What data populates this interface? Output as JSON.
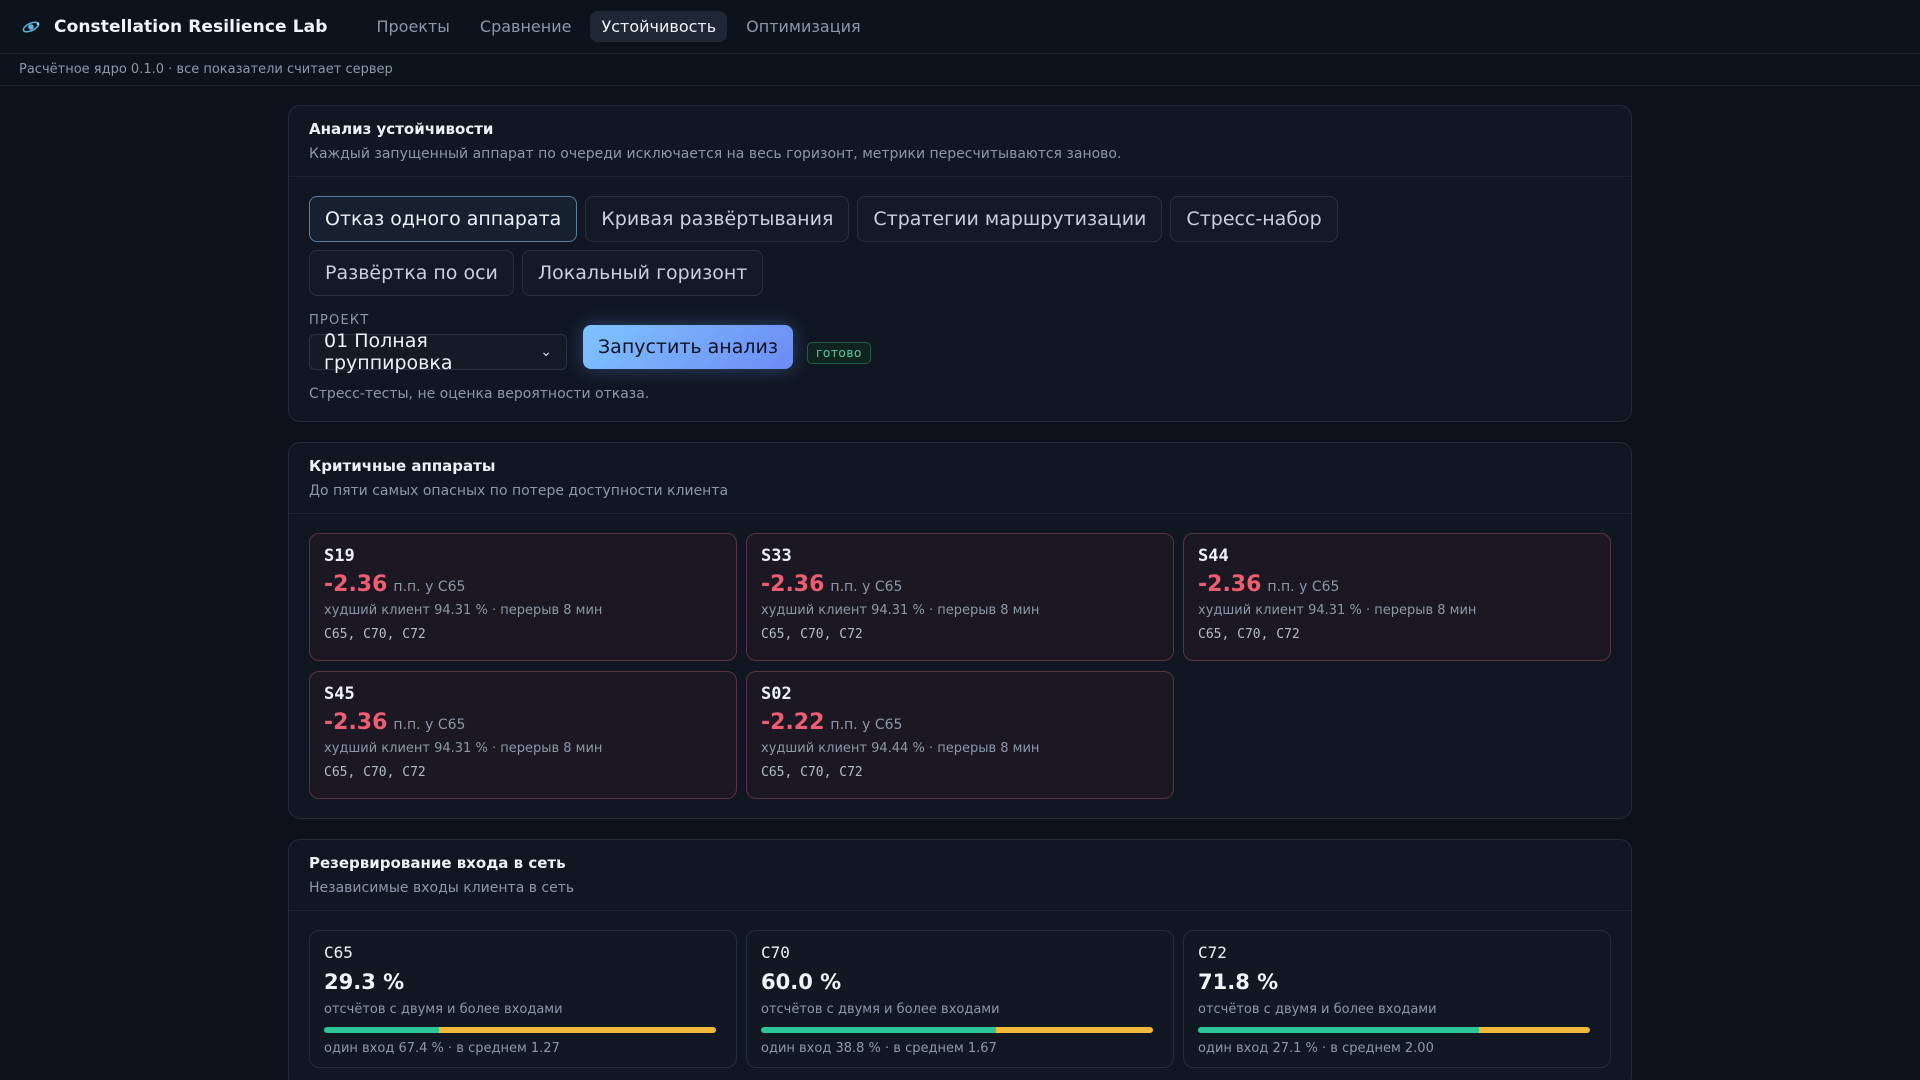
{
  "header": {
    "app_title": "Constellation Resilience Lab",
    "logo_icon": "satellite-icon",
    "nav": [
      {
        "label": "Проекты"
      },
      {
        "label": "Сравнение"
      },
      {
        "label": "Устойчивость",
        "active": true
      },
      {
        "label": "Оптимизация"
      }
    ],
    "subtitle": "Расчётное ядро 0.1.0 · все показатели считает сервер"
  },
  "analysis": {
    "title": "Анализ устойчивости",
    "subtitle": "Каждый запущенный аппарат по очереди исключается на весь горизонт, метрики пересчитываются заново.",
    "modes": [
      {
        "label": "Отказ одного аппарата",
        "active": true
      },
      {
        "label": "Кривая развёртывания"
      },
      {
        "label": "Стратегии маршрутизации"
      },
      {
        "label": "Стресс-набор"
      },
      {
        "label": "Развёртка по оси"
      },
      {
        "label": "Локальный горизонт"
      }
    ],
    "project_label": "ПРОЕКТ",
    "project_value": "01 Полная группировка",
    "run_label": "Запустить анализ",
    "status": "готово",
    "note": "Стресс-тесты, не оценка вероятности отказа."
  },
  "critical": {
    "title": "Критичные аппараты",
    "subtitle": "До пяти самых опасных по потере доступности клиента",
    "items": [
      {
        "name": "S19",
        "delta": "-2.36",
        "unit": "п.п. у C65",
        "detail": "худший клиент 94.31 % · перерыв 8 мин",
        "clients": "C65, C70, C72"
      },
      {
        "name": "S33",
        "delta": "-2.36",
        "unit": "п.п. у C65",
        "detail": "худший клиент 94.31 % · перерыв 8 мин",
        "clients": "C65, C70, C72"
      },
      {
        "name": "S44",
        "delta": "-2.36",
        "unit": "п.п. у C65",
        "detail": "худший клиент 94.31 % · перерыв 8 мин",
        "clients": "C65, C70, C72"
      },
      {
        "name": "S45",
        "delta": "-2.36",
        "unit": "п.п. у C65",
        "detail": "худший клиент 94.31 % · перерыв 8 мин",
        "clients": "C65, C70, C72"
      },
      {
        "name": "S02",
        "delta": "-2.22",
        "unit": "п.п. у C65",
        "detail": "худший клиент 94.44 % · перерыв 8 мин",
        "clients": "C65, C70, C72"
      }
    ]
  },
  "redundancy": {
    "title": "Резервирование входа в сеть",
    "subtitle": "Независимые входы клиента в сеть",
    "items": [
      {
        "name": "C65",
        "pct": "29.3 %",
        "desc": "отсчётов с двумя и более входами",
        "multi_fraction": 0.293,
        "foot": "один вход 67.4 % · в среднем 1.27"
      },
      {
        "name": "C70",
        "pct": "60.0 %",
        "desc": "отсчётов с двумя и более входами",
        "multi_fraction": 0.6,
        "foot": "один вход 38.8 % · в среднем 1.67"
      },
      {
        "name": "C72",
        "pct": "71.8 %",
        "desc": "отсчётов с двумя и более входами",
        "multi_fraction": 0.718,
        "foot": "один вход 27.1 % · в среднем 2.00"
      }
    ]
  },
  "colors": {
    "accent": "#6c8bf5",
    "danger": "#ef5d72",
    "multi_bar": "#2ec79a",
    "single_bar": "#f2b93b",
    "ready": "#4fd1a0"
  }
}
